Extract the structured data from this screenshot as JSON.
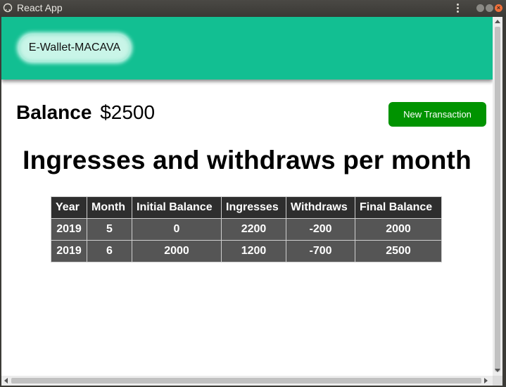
{
  "window": {
    "title": "React App",
    "icon": "app-logo-icon"
  },
  "header": {
    "brand": "E-Wallet-MACAVA",
    "color": "#12bf92"
  },
  "balance": {
    "label": "Balance",
    "value": "$2500"
  },
  "actions": {
    "new_transaction": "New Transaction",
    "color": "#009300"
  },
  "heading": "Ingresses and withdraws per month",
  "table": {
    "headers": [
      "Year",
      "Month",
      "Initial Balance",
      "Ingresses",
      "Withdraws",
      "Final Balance"
    ],
    "rows": [
      [
        "2019",
        "5",
        "0",
        "2200",
        "-200",
        "2000"
      ],
      [
        "2019",
        "6",
        "2000",
        "1200",
        "-700",
        "2500"
      ]
    ]
  }
}
